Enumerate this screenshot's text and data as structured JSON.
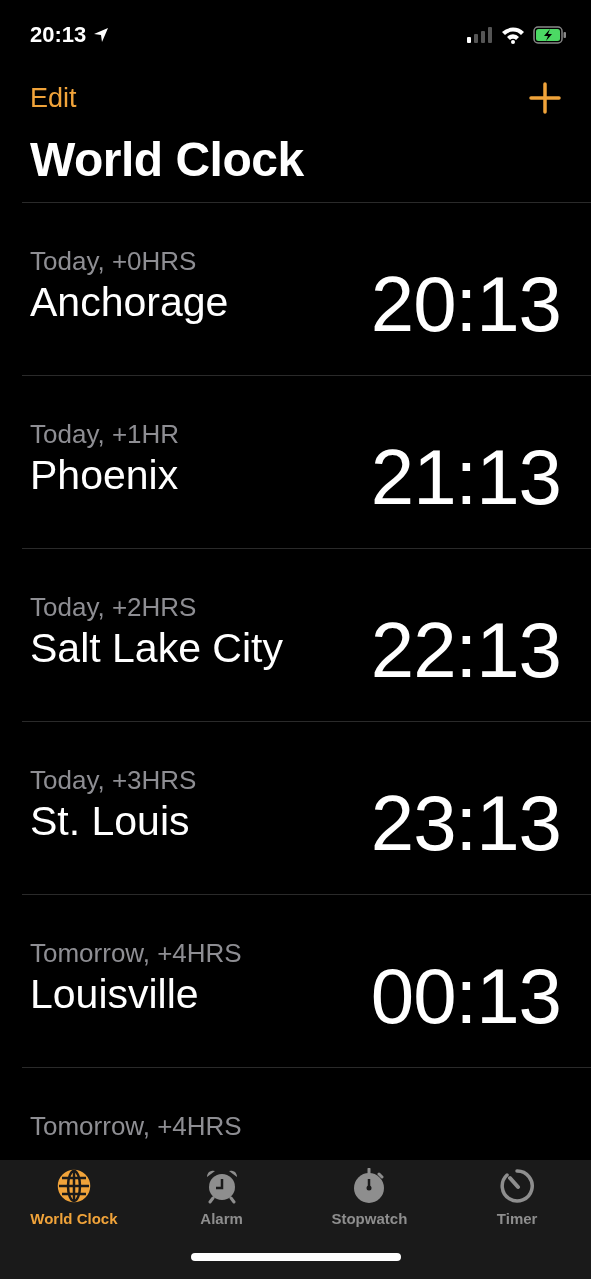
{
  "status_bar": {
    "time": "20:13"
  },
  "nav": {
    "edit": "Edit",
    "title": "World Clock"
  },
  "clocks": [
    {
      "offset": "Today, +0HRS",
      "city": "Anchorage",
      "time": "20:13"
    },
    {
      "offset": "Today, +1HR",
      "city": "Phoenix",
      "time": "21:13"
    },
    {
      "offset": "Today, +2HRS",
      "city": "Salt Lake City",
      "time": "22:13"
    },
    {
      "offset": "Today, +3HRS",
      "city": "St. Louis",
      "time": "23:13"
    },
    {
      "offset": "Tomorrow, +4HRS",
      "city": "Louisville",
      "time": "00:13"
    },
    {
      "offset": "Tomorrow, +4HRS"
    }
  ],
  "tabs": [
    {
      "kind": "globe",
      "label": "World Clock",
      "selected": true
    },
    {
      "kind": "alarm",
      "label": "Alarm",
      "selected": false
    },
    {
      "kind": "stopwatch",
      "label": "Stopwatch",
      "selected": false
    },
    {
      "kind": "timer",
      "label": "Timer",
      "selected": false
    }
  ]
}
